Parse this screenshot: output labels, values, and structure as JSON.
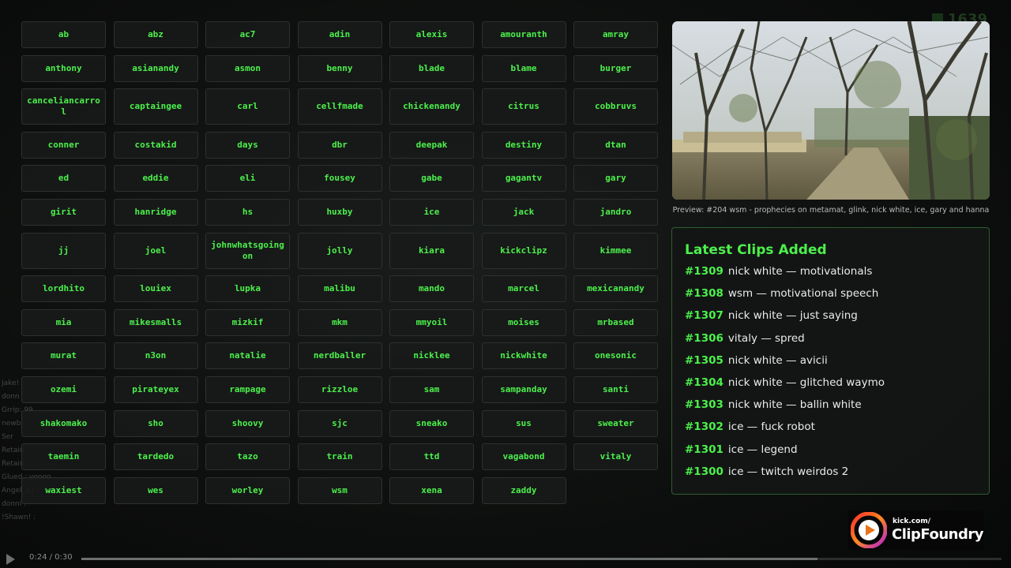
{
  "background": {
    "counter": "1639",
    "chat_lines": [
      "Jake!",
      "donn",
      "Grrip: 99",
      "newb",
      "Ser",
      "Retain",
      "Retain",
      "Glued : yoooo",
      "Angel_12 :",
      "donni :",
      "!Shawn! :"
    ]
  },
  "streamers": [
    "ab",
    "abz",
    "ac7",
    "adin",
    "alexis",
    "amouranth",
    "amray",
    "anthony",
    "asianandy",
    "asmon",
    "benny",
    "blade",
    "blame",
    "burger",
    "canceliancarrol",
    "captaingee",
    "carl",
    "cellfmade",
    "chickenandy",
    "citrus",
    "cobbruvs",
    "conner",
    "costakid",
    "days",
    "dbr",
    "deepak",
    "destiny",
    "dtan",
    "ed",
    "eddie",
    "eli",
    "fousey",
    "gabe",
    "gagantv",
    "gary",
    "girit",
    "hanridge",
    "hs",
    "huxby",
    "ice",
    "jack",
    "jandro",
    "jj",
    "joel",
    "johnwhatsgoingon",
    "jolly",
    "kiara",
    "kickclipz",
    "kimmee",
    "lordhito",
    "louiex",
    "lupka",
    "malibu",
    "mando",
    "marcel",
    "mexicanandy",
    "mia",
    "mikesmalls",
    "mizkif",
    "mkm",
    "mmyoil",
    "moises",
    "mrbased",
    "murat",
    "n3on",
    "natalie",
    "nerdballer",
    "nicklee",
    "nickwhite",
    "onesonic",
    "ozemi",
    "pirateyex",
    "rampage",
    "rizzloe",
    "sam",
    "sampanday",
    "santi",
    "shakomako",
    "sho",
    "shoovy",
    "sjc",
    "sneako",
    "sus",
    "sweater",
    "taemin",
    "tardedo",
    "tazo",
    "train",
    "ttd",
    "vagabond",
    "vitaly",
    "waxiest",
    "wes",
    "worley",
    "wsm",
    "xena",
    "zaddy"
  ],
  "tall_rows": [
    2,
    6
  ],
  "preview": {
    "caption": "Preview: #204 wsm - prophecies on metamat, glink, nick white, ice, gary and hanna"
  },
  "clips": {
    "title": "Latest Clips Added",
    "items": [
      {
        "id": "#1309",
        "text": "nick white — motivationals"
      },
      {
        "id": "#1308",
        "text": "wsm — motivational speech"
      },
      {
        "id": "#1307",
        "text": "nick white — just saying"
      },
      {
        "id": "#1306",
        "text": "vitaly — spred"
      },
      {
        "id": "#1305",
        "text": "nick white — avicii"
      },
      {
        "id": "#1304",
        "text": "nick white — glitched waymo"
      },
      {
        "id": "#1303",
        "text": "nick white — ballin white"
      },
      {
        "id": "#1302",
        "text": "ice — fuck robot"
      },
      {
        "id": "#1301",
        "text": "ice — legend"
      },
      {
        "id": "#1300",
        "text": "ice — twitch weirdos 2"
      }
    ]
  },
  "logo": {
    "small": "kick.com/",
    "big": "ClipFoundry"
  },
  "player": {
    "time": "0:24 / 0:30",
    "progress": 0.8
  },
  "colors": {
    "accent": "#4cf04c",
    "panel_border": "#2c5e2e",
    "button_bg": "#181a19"
  }
}
